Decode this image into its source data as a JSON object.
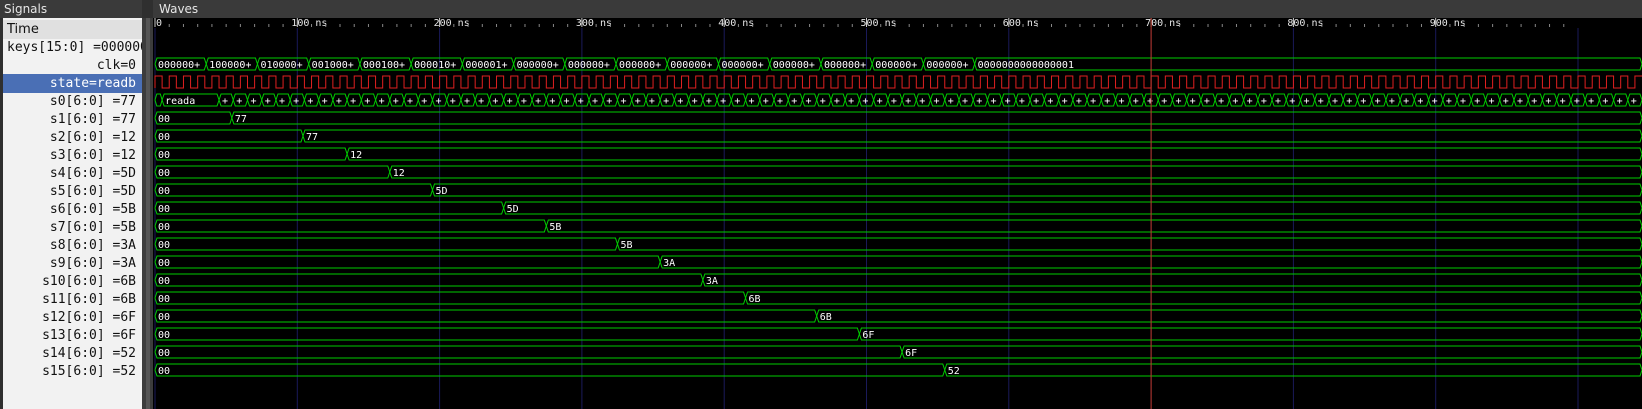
{
  "panels": {
    "signals_title": "Signals",
    "waves_title": "Waves"
  },
  "time_header": "Time",
  "signals": [
    {
      "label": "keys[15:0] =000000"
    },
    {
      "label": "clk=0"
    },
    {
      "label": "state=readb"
    },
    {
      "label": "s0[6:0] =77"
    },
    {
      "label": "s1[6:0] =77"
    },
    {
      "label": "s2[6:0] =12"
    },
    {
      "label": "s3[6:0] =12"
    },
    {
      "label": "s4[6:0] =5D"
    },
    {
      "label": "s5[6:0] =5D"
    },
    {
      "label": "s6[6:0] =5B"
    },
    {
      "label": "s7[6:0] =5B"
    },
    {
      "label": "s8[6:0] =3A"
    },
    {
      "label": "s9[6:0] =3A"
    },
    {
      "label": "s10[6:0] =6B"
    },
    {
      "label": "s11[6:0] =6B"
    },
    {
      "label": "s12[6:0] =6F"
    },
    {
      "label": "s13[6:0] =6F"
    },
    {
      "label": "s14[6:0] =52"
    },
    {
      "label": "s15[6:0] =52"
    }
  ],
  "timescale": {
    "labels": [
      "0",
      "100 ns",
      "200 ns",
      "300 ns",
      "400 ns",
      "500 ns",
      "600 ns",
      "700 ns",
      "800 ns",
      "900 ns"
    ],
    "max_ns": 1000,
    "cursor_ns": 700
  },
  "waves": {
    "keys": {
      "segments": [
        {
          "start": 0,
          "value": "0000000+"
        },
        {
          "start": 36,
          "value": "1000000+"
        },
        {
          "start": 72,
          "value": "0100000+"
        },
        {
          "start": 108,
          "value": "0010000+"
        },
        {
          "start": 144,
          "value": "0001000+"
        },
        {
          "start": 180,
          "value": "0000100+"
        },
        {
          "start": 216,
          "value": "0000010+"
        },
        {
          "start": 252,
          "value": "0000001+"
        },
        {
          "start": 288,
          "value": "0000000+"
        },
        {
          "start": 324,
          "value": "0000000+"
        },
        {
          "start": 360,
          "value": "0000000+"
        },
        {
          "start": 396,
          "value": "0000000+"
        },
        {
          "start": 432,
          "value": "0000000+"
        },
        {
          "start": 468,
          "value": "0000000+"
        },
        {
          "start": 504,
          "value": "0000000+"
        },
        {
          "start": 540,
          "value": "0000000+"
        },
        {
          "start": 576,
          "value": "0000000000000001"
        }
      ]
    },
    "clk": {
      "period_ns": 10
    },
    "state": {
      "first_value": "reada",
      "first_start_ns": 5,
      "first_end_ns": 45,
      "step_ns": 10,
      "short_label": "+"
    },
    "segs": [
      {
        "initial": "00",
        "change_ns": 54,
        "value": "77"
      },
      {
        "initial": "00",
        "change_ns": 104,
        "value": "77"
      },
      {
        "initial": "00",
        "change_ns": 135,
        "value": "12"
      },
      {
        "initial": "00",
        "change_ns": 165,
        "value": "12"
      },
      {
        "initial": "00",
        "change_ns": 195,
        "value": "5D"
      },
      {
        "initial": "00",
        "change_ns": 245,
        "value": "5D"
      },
      {
        "initial": "00",
        "change_ns": 275,
        "value": "5B"
      },
      {
        "initial": "00",
        "change_ns": 325,
        "value": "5B"
      },
      {
        "initial": "00",
        "change_ns": 355,
        "value": "3A"
      },
      {
        "initial": "00",
        "change_ns": 385,
        "value": "3A"
      },
      {
        "initial": "00",
        "change_ns": 415,
        "value": "6B"
      },
      {
        "initial": "00",
        "change_ns": 465,
        "value": "6B"
      },
      {
        "initial": "00",
        "change_ns": 495,
        "value": "6F"
      },
      {
        "initial": "00",
        "change_ns": 525,
        "value": "6F"
      },
      {
        "initial": "00",
        "change_ns": 555,
        "value": "52"
      },
      {
        "initial": "00",
        "change_ns": 605,
        "value": "52"
      }
    ]
  },
  "colors": {
    "wave": "#00cc00",
    "clock": "#e02020",
    "cursor": "#c0392b",
    "grid": "#1a1a5a",
    "background": "#000000",
    "ruler_text": "#e6e6e6",
    "value_text": "#ffffff",
    "bus_fill": "#0a2a0a"
  }
}
